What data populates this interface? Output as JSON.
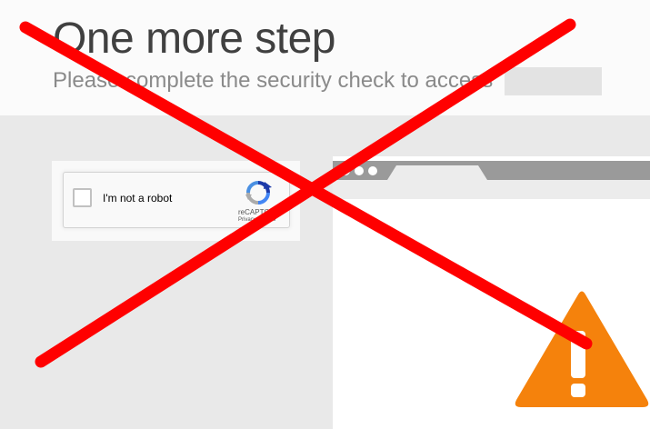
{
  "header": {
    "title": "One more step",
    "subtitle": "Please complete the security check to access"
  },
  "captcha": {
    "checkbox_label": "I'm not a robot",
    "brand": "reCAPTCHA",
    "links": "Privacy - Terms"
  },
  "icons": {
    "recaptcha": "recaptcha-logo-icon",
    "warning": "warning-triangle-icon",
    "cross": "red-x-overlay"
  },
  "colors": {
    "cross": "#ff0000",
    "warning": "#f5820c",
    "title_text": "#404040",
    "subtitle_text": "#8a8a8a",
    "browser_bar": "#9a9a9a"
  }
}
